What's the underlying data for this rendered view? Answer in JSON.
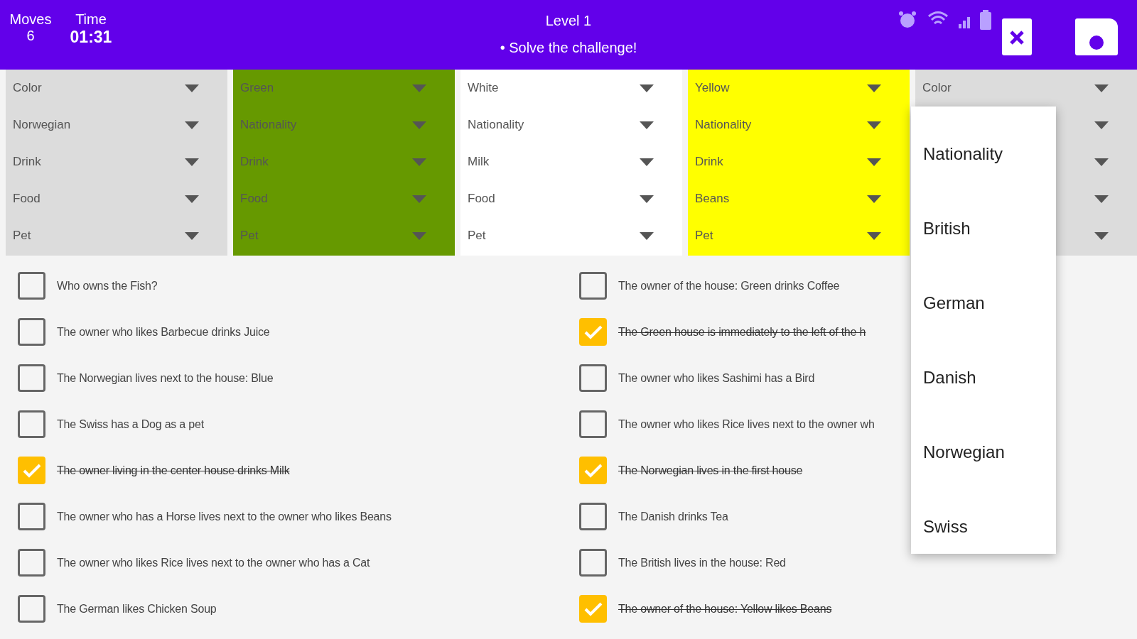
{
  "header": {
    "moves_label": "Moves",
    "moves": "6",
    "time_label": "Time",
    "time": "01:31",
    "title": "Level 1",
    "subtitle": "• Solve the challenge!"
  },
  "houses": [
    {
      "color": "#dcdcdc",
      "fields": [
        "Color",
        "Norwegian",
        "Drink",
        "Food",
        "Pet"
      ]
    },
    {
      "color": "#669900",
      "fields": [
        "Green",
        "Nationality",
        "Drink",
        "Food",
        "Pet"
      ]
    },
    {
      "color": "#ffffff",
      "fields": [
        "White",
        "Nationality",
        "Milk",
        "Food",
        "Pet"
      ]
    },
    {
      "color": "#ffff00",
      "fields": [
        "Yellow",
        "Nationality",
        "Drink",
        "Beans",
        "Pet"
      ]
    },
    {
      "color": "#dcdcdc",
      "fields": [
        "Color"
      ]
    }
  ],
  "clue_columns": [
    [
      {
        "text": "Who owns the Fish?",
        "checked": false
      },
      {
        "text": "The owner who likes Barbecue drinks Juice",
        "checked": false
      },
      {
        "text": "The Norwegian lives next to the house: Blue",
        "checked": false
      },
      {
        "text": "The Swiss has a Dog as a pet",
        "checked": false
      },
      {
        "text": "The owner living in the center house drinks Milk",
        "checked": true
      },
      {
        "text": "The owner who has a Horse lives next to the owner who likes Beans",
        "checked": false
      },
      {
        "text": "The owner who likes Rice lives next to the owner who has a Cat",
        "checked": false
      },
      {
        "text": "The German likes Chicken Soup",
        "checked": false
      }
    ],
    [
      {
        "text": "The owner of the house: Green drinks Coffee",
        "checked": false
      },
      {
        "text": "The Green house is immediately to the left of the h",
        "checked": true
      },
      {
        "text": "The owner who likes Sashimi has a Bird",
        "checked": false
      },
      {
        "text": "The owner who likes Rice lives next to the owner wh",
        "checked": false
      },
      {
        "text": "The Norwegian lives in the first house",
        "checked": true
      },
      {
        "text": "The Danish drinks Tea",
        "checked": false
      },
      {
        "text": "The British lives in the house: Red",
        "checked": false
      },
      {
        "text": "The owner of the house: Yellow likes Beans",
        "checked": true
      }
    ]
  ],
  "dropdown_menu": {
    "items": [
      "Nationality",
      "British",
      "German",
      "Danish",
      "Norwegian",
      "Swiss"
    ]
  }
}
